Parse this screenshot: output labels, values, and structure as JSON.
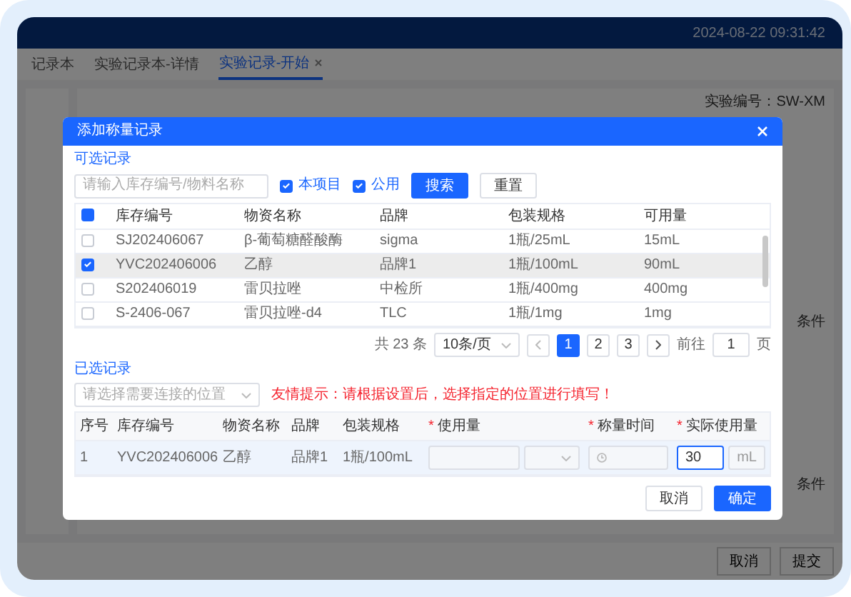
{
  "app": {
    "datetime": "2024-08-22 09:31:42",
    "tabs": [
      {
        "label": "记录本",
        "selected": false,
        "closable": false
      },
      {
        "label": "实验记录本-详情",
        "selected": false,
        "closable": false
      },
      {
        "label": "实验记录-开始",
        "selected": true,
        "closable": true
      }
    ],
    "experiment_id": "实验编号：SW-XM",
    "right_labels": [
      "条件",
      "条件"
    ],
    "footer_buttons": [
      "取消",
      "提交"
    ]
  },
  "dialog": {
    "title": "添加称量记录",
    "available": {
      "heading": "可选记录",
      "search": {
        "placeholder": "请输入库存编号/物料名称"
      },
      "filters": [
        {
          "label": "本项目",
          "checked": true
        },
        {
          "label": "公用",
          "checked": true
        }
      ],
      "buttons": [
        {
          "label": "搜索",
          "kind": "primary"
        },
        {
          "label": "重置",
          "kind": "default"
        }
      ],
      "select_all": {
        "indeterminate": true
      },
      "columns": [
        "库存编号",
        "物资名称",
        "品牌",
        "包装规格",
        "可用量"
      ],
      "rows": [
        {
          "cells": [
            "SJ202406067",
            "β-葡萄糖醛酸酶",
            "sigma",
            "1瓶/25mL",
            "15mL"
          ],
          "checked": false,
          "selected": false
        },
        {
          "cells": [
            "YVC202406006",
            "乙醇",
            "品牌1",
            "1瓶/100mL",
            "90mL"
          ],
          "checked": true,
          "selected": true
        },
        {
          "cells": [
            "S202406019",
            "雷贝拉唑",
            "中检所",
            "1瓶/400mg",
            "400mg"
          ],
          "checked": false,
          "selected": false
        },
        {
          "cells": [
            "S-2406-067",
            "雷贝拉唑-d4",
            "TLC",
            "1瓶/1mg",
            "1mg"
          ],
          "checked": false,
          "selected": false
        }
      ],
      "pagination": {
        "total": "共 23 条",
        "page_size": "10条/页",
        "pages": [
          {
            "label": "1",
            "selected": true
          },
          {
            "label": "2",
            "selected": false
          },
          {
            "label": "3",
            "selected": false
          }
        ],
        "goto_label": "前往",
        "goto_value": "1",
        "page_suffix": "页"
      }
    },
    "chosen": {
      "heading": "已选记录",
      "position_select": {
        "placeholder": "请选择需要连接的位置"
      },
      "tip": "友情提示：请根据设置后，选择指定的位置进行填写！",
      "columns": [
        {
          "label": "序号"
        },
        {
          "label": "库存编号"
        },
        {
          "label": "物资名称"
        },
        {
          "label": "品牌"
        },
        {
          "label": "包装规格"
        },
        {
          "label": "使用量",
          "required_mark": "*"
        },
        {
          "label": "称量时间",
          "required_mark": "*"
        },
        {
          "label": "实际使用量",
          "required_mark": "*"
        }
      ],
      "rows": [
        {
          "cells": [
            "1",
            "YVC202406006",
            "乙醇",
            "品牌1",
            "1瓶/100mL"
          ],
          "actual_amount": "30",
          "unit": "mL"
        }
      ]
    },
    "buttons": [
      {
        "label": "取消",
        "kind": "default"
      },
      {
        "label": "确定",
        "kind": "primary"
      }
    ]
  }
}
